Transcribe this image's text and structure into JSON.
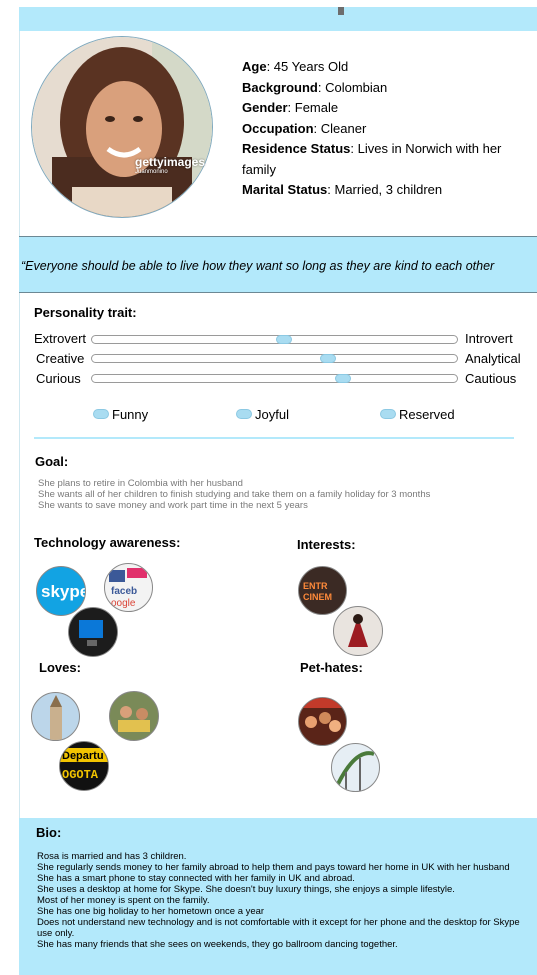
{
  "profile": {
    "watermark": "gettyimages",
    "watermark_sub": "Juanmonino",
    "fields": [
      {
        "label": "Age",
        "value": "45 Years Old"
      },
      {
        "label": "Background",
        "value": "Colombian"
      },
      {
        "label": "Gender",
        "value": "Female"
      },
      {
        "label": "Occupation",
        "value": "Cleaner"
      },
      {
        "label": "Residence Status",
        "value": "Lives in Norwich with her family"
      },
      {
        "label": "Marital Status",
        "value": "Married, 3 children"
      }
    ]
  },
  "quote": "“Everyone should be able to live how they want so long as they are kind to each other",
  "personality": {
    "title": "Personality trait:",
    "sliders": [
      {
        "left": "Extrovert",
        "right": "Introvert",
        "value": 0.53
      },
      {
        "left": "Creative",
        "right": "Analytical",
        "value": 0.65
      },
      {
        "left": "Curious",
        "right": "Cautious",
        "value": 0.69
      }
    ],
    "moods": [
      "Funny",
      "Joyful",
      "Reserved"
    ]
  },
  "goal": {
    "title": "Goal:",
    "lines": [
      "She plans to retire in Colombia with her husband",
      "She wants all of her children to finish studying and take them on a family holiday for 3 months",
      "She wants to save money and work part time in the next 5 years"
    ]
  },
  "technology": {
    "title": "Technology awareness:",
    "icons": [
      "skype-logo",
      "social-media-logos",
      "windows-desktop"
    ]
  },
  "interests": {
    "title": "Interests:",
    "icons": [
      "cinema-sign",
      "ballroom-dancing"
    ]
  },
  "loves": {
    "title": "Loves:",
    "icons": [
      "church-tower",
      "family-picnic",
      "bogota-departures-board"
    ],
    "departure_text": "Departu",
    "bogota_text": "OGOTA"
  },
  "pet_hates": {
    "title": "Pet-hates:",
    "icons": [
      "crowded-party",
      "rollercoaster"
    ]
  },
  "bio": {
    "title": "Bio:",
    "text": "Rosa is married and has 3 children.\nShe regularly sends money to her family abroad to help them and pays toward her home in UK with her husband\nShe has a smart phone to stay connected with her family in UK and abroad.\nShe uses a desktop at home for Skype.  She doesn't buy luxury things, she enjoys a simple lifestyle.\nMost of her money is spent on the family.\nShe has one big holiday to her hometown once a year\nDoes not understand new technology and is not comfortable with it except for her phone and the desktop for Skype use only.\nShe has many friends that she sees on weekends, they go ballroom dancing together."
  },
  "colors": {
    "accent": "#b3e9fb",
    "knob": "#a9dcf1"
  }
}
